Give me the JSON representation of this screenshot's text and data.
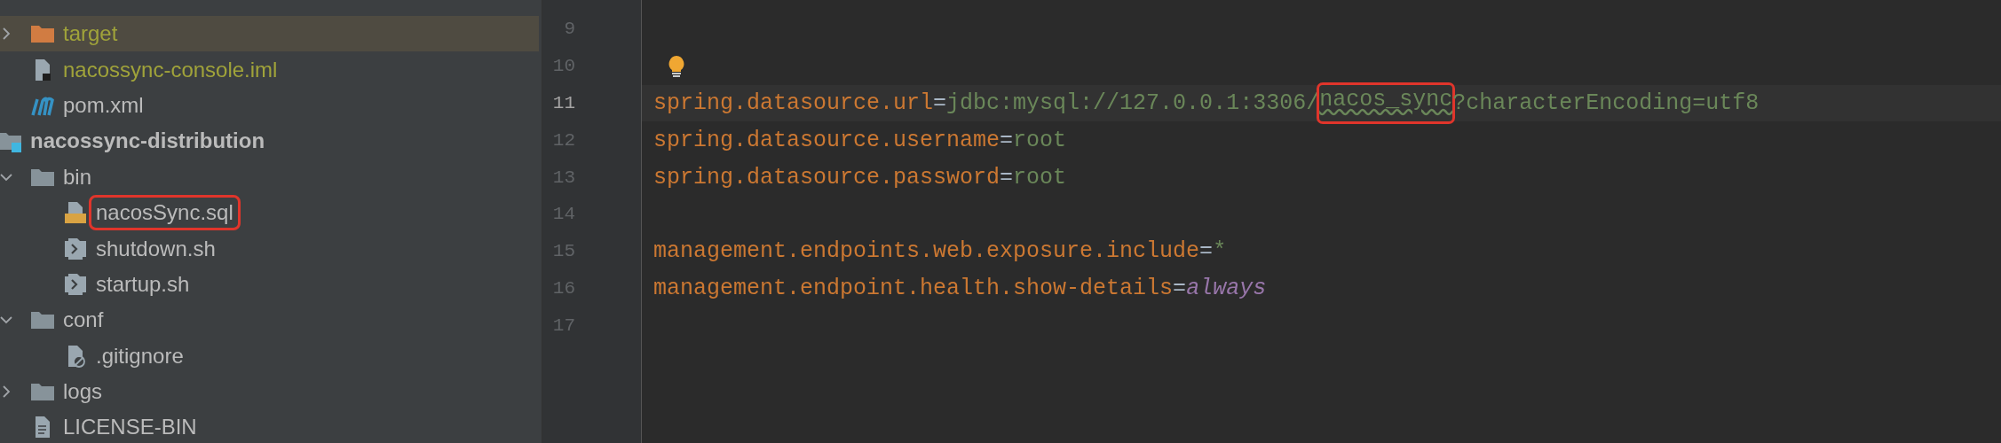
{
  "tree": [
    {
      "children": [
        {
          "label": "target",
          "kind": "excluded-folder",
          "expanded": false,
          "selected": true,
          "ignored": true,
          "outlined": false
        },
        {
          "label": "nacossync-console.iml",
          "kind": "iml",
          "selected": false,
          "ignored": true,
          "outlined": false
        },
        {
          "label": "pom.xml",
          "kind": "maven",
          "selected": false,
          "ignored": false,
          "outlined": false
        }
      ]
    },
    {
      "label": "nacossync-distribution",
      "kind": "module",
      "selected": false,
      "ignored": false,
      "outlined": false,
      "children": [
        {
          "label": "bin",
          "kind": "folder",
          "expanded": true,
          "selected": false,
          "ignored": false,
          "outlined": false,
          "children": [
            {
              "label": "nacosSync.sql",
              "kind": "sql",
              "selected": false,
              "ignored": false,
              "outlined": true
            },
            {
              "label": "shutdown.sh",
              "kind": "script",
              "selected": false,
              "ignored": false,
              "outlined": false
            },
            {
              "label": "startup.sh",
              "kind": "script",
              "selected": false,
              "ignored": false,
              "outlined": false
            }
          ]
        },
        {
          "label": "conf",
          "kind": "folder",
          "expanded": true,
          "selected": false,
          "ignored": false,
          "outlined": false,
          "children": [
            {
              "label": ".gitignore",
              "kind": "gitignore",
              "selected": false,
              "ignored": false,
              "outlined": false
            }
          ]
        },
        {
          "label": "logs",
          "kind": "folder",
          "expanded": false,
          "selected": false,
          "ignored": false,
          "outlined": false
        },
        {
          "label": "LICENSE-BIN",
          "kind": "text",
          "selected": false,
          "ignored": false,
          "outlined": false
        }
      ]
    }
  ],
  "editor": {
    "lines": [
      {
        "number": "9",
        "current": false
      },
      {
        "number": "10",
        "current": false,
        "bulb": true
      },
      {
        "number": "11",
        "current": true,
        "tokens": [
          {
            "text": "spring.datasource.url",
            "kind": "key"
          },
          {
            "text": "=",
            "kind": "op"
          },
          {
            "text": "jdbc:mysql://127.0.0.1:3306/",
            "kind": "value"
          },
          {
            "text": "nacos_sync",
            "kind": "marked"
          },
          {
            "text": "?characterEncoding=utf8",
            "kind": "value"
          }
        ]
      },
      {
        "number": "12",
        "current": false,
        "tokens": [
          {
            "text": "spring.datasource.username",
            "kind": "key"
          },
          {
            "text": "=",
            "kind": "op"
          },
          {
            "text": "root",
            "kind": "value"
          }
        ]
      },
      {
        "number": "13",
        "current": false,
        "tokens": [
          {
            "text": "spring.datasource.password",
            "kind": "key"
          },
          {
            "text": "=",
            "kind": "op"
          },
          {
            "text": "root",
            "kind": "value"
          }
        ]
      },
      {
        "number": "14",
        "current": false
      },
      {
        "number": "15",
        "current": false,
        "tokens": [
          {
            "text": "management.endpoints.web.exposure.include",
            "kind": "key"
          },
          {
            "text": "=",
            "kind": "op"
          },
          {
            "text": "*",
            "kind": "value"
          }
        ]
      },
      {
        "number": "16",
        "current": false,
        "tokens": [
          {
            "text": "management.endpoint.health.show-details",
            "kind": "key"
          },
          {
            "text": "=",
            "kind": "op"
          },
          {
            "text": "always",
            "kind": "constant"
          }
        ]
      },
      {
        "number": "17",
        "current": false
      }
    ]
  }
}
